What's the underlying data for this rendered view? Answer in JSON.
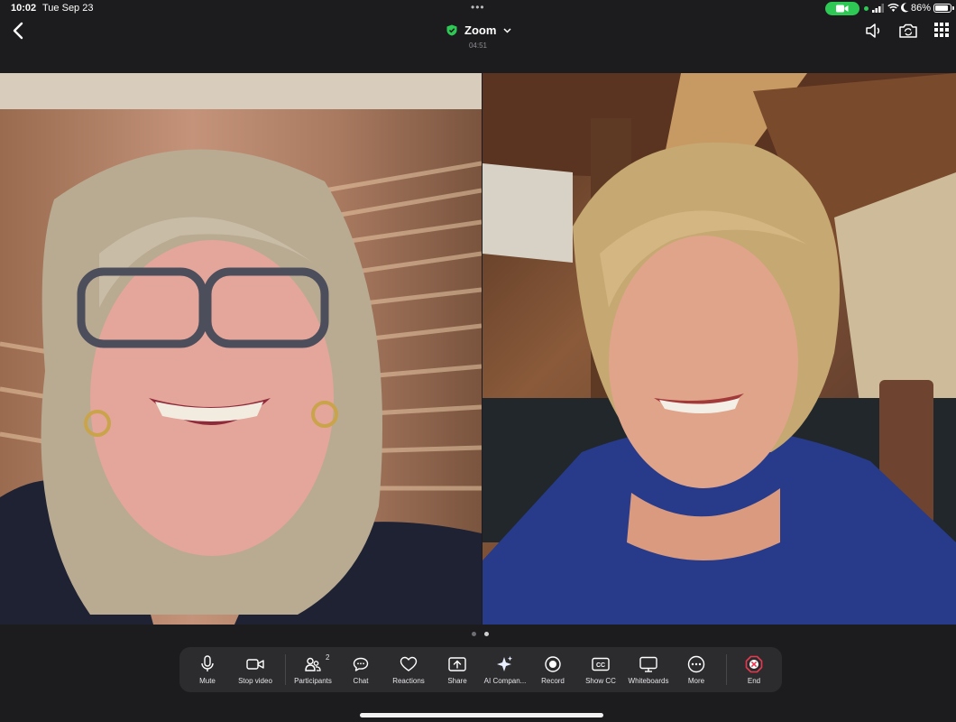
{
  "status_bar": {
    "time": "10:02",
    "date": "Tue Sep 23",
    "battery_percent": "86%",
    "battery_level": 0.86,
    "camera_indicator_color": "#2ec955"
  },
  "header": {
    "back_icon": "chevron-left-icon",
    "title": "Zoom",
    "encryption_icon": "shield-check-icon",
    "dropdown_icon": "chevron-down-icon",
    "timer": "04:51",
    "right_icons": [
      "speaker-icon",
      "switch-camera-icon",
      "grid-icon"
    ]
  },
  "videos": [
    {
      "id": "participant-1",
      "active": false
    },
    {
      "id": "participant-2",
      "active": false
    }
  ],
  "pager": {
    "pages": 2,
    "current": 2
  },
  "toolbar": {
    "mute": {
      "label": "Mute",
      "icon": "microphone-icon"
    },
    "stop_video": {
      "label": "Stop video",
      "icon": "video-camera-icon"
    },
    "participants": {
      "label": "Participants",
      "icon": "participants-icon",
      "count": "2"
    },
    "chat": {
      "label": "Chat",
      "icon": "chat-icon"
    },
    "reactions": {
      "label": "Reactions",
      "icon": "heart-icon"
    },
    "share": {
      "label": "Share",
      "icon": "share-screen-icon"
    },
    "ai_companion": {
      "label": "AI Compan...",
      "icon": "sparkle-icon"
    },
    "record": {
      "label": "Record",
      "icon": "record-icon"
    },
    "show_cc": {
      "label": "Show CC",
      "icon": "closed-caption-icon"
    },
    "whiteboards": {
      "label": "Whiteboards",
      "icon": "whiteboard-icon"
    },
    "more": {
      "label": "More",
      "icon": "more-icon"
    },
    "end": {
      "label": "End",
      "icon": "end-call-icon",
      "color": "#e8384f"
    }
  },
  "colors": {
    "accent": "#2ec955",
    "end": "#e8384f",
    "toolbar_bg": "#2c2c2e"
  }
}
